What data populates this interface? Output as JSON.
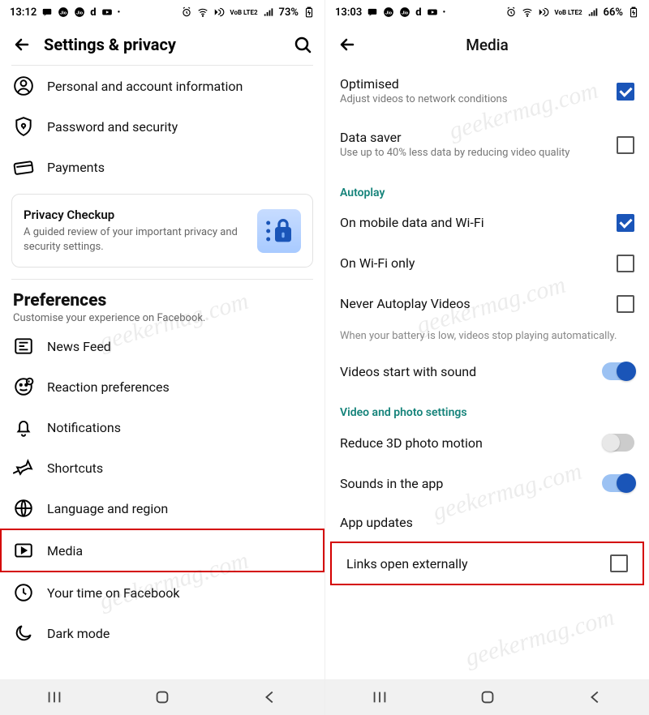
{
  "left": {
    "status": {
      "time": "13:12",
      "battery": "73%",
      "netlabel": "VoB LTE2"
    },
    "header": {
      "title": "Settings & privacy"
    },
    "items_top": [
      {
        "name": "personal-account",
        "label": "Personal and account information"
      },
      {
        "name": "password-security",
        "label": "Password and security"
      },
      {
        "name": "payments",
        "label": "Payments"
      }
    ],
    "privacy_card": {
      "title": "Privacy Checkup",
      "desc": "A guided review of your important privacy and security settings."
    },
    "preferences": {
      "title": "Preferences",
      "desc": "Customise your experience on Facebook."
    },
    "pref_items": [
      {
        "name": "news-feed",
        "label": "News Feed"
      },
      {
        "name": "reaction-prefs",
        "label": "Reaction preferences"
      },
      {
        "name": "notifications",
        "label": "Notifications"
      },
      {
        "name": "shortcuts",
        "label": "Shortcuts"
      },
      {
        "name": "language-region",
        "label": "Language and region"
      },
      {
        "name": "media",
        "label": "Media",
        "highlight": true
      },
      {
        "name": "your-time",
        "label": "Your time on Facebook"
      },
      {
        "name": "dark-mode",
        "label": "Dark mode"
      }
    ]
  },
  "right": {
    "status": {
      "time": "13:03",
      "battery": "66%",
      "netlabel": "VoB LTE2"
    },
    "header": {
      "title": "Media"
    },
    "rows1": [
      {
        "name": "optimised",
        "title": "Optimised",
        "desc": "Adjust videos to network conditions",
        "checked": true
      },
      {
        "name": "data-saver",
        "title": "Data saver",
        "desc": "Use up to 40% less data by reducing video quality",
        "checked": false
      }
    ],
    "section_autoplay": "Autoplay",
    "rows2": [
      {
        "name": "mobile-wifi",
        "title": "On mobile data and Wi-Fi",
        "checked": true
      },
      {
        "name": "wifi-only",
        "title": "On Wi-Fi only",
        "checked": false
      },
      {
        "name": "never-autoplay",
        "title": "Never Autoplay Videos",
        "checked": false
      }
    ],
    "helper_autoplay": "When your battery is low, videos stop playing automatically.",
    "rows3": [
      {
        "name": "videos-sound",
        "title": "Videos start with sound",
        "toggle": true
      }
    ],
    "section_video": "Video and photo settings",
    "rows4": [
      {
        "name": "reduce-3d",
        "title": "Reduce 3D photo motion",
        "toggle": false
      },
      {
        "name": "sounds-app",
        "title": "Sounds in the app",
        "toggle": true
      },
      {
        "name": "app-updates",
        "title": "App updates"
      },
      {
        "name": "links-external",
        "title": "Links open externally",
        "checked": false,
        "highlight": true
      }
    ]
  },
  "watermark": "geekermag.com"
}
